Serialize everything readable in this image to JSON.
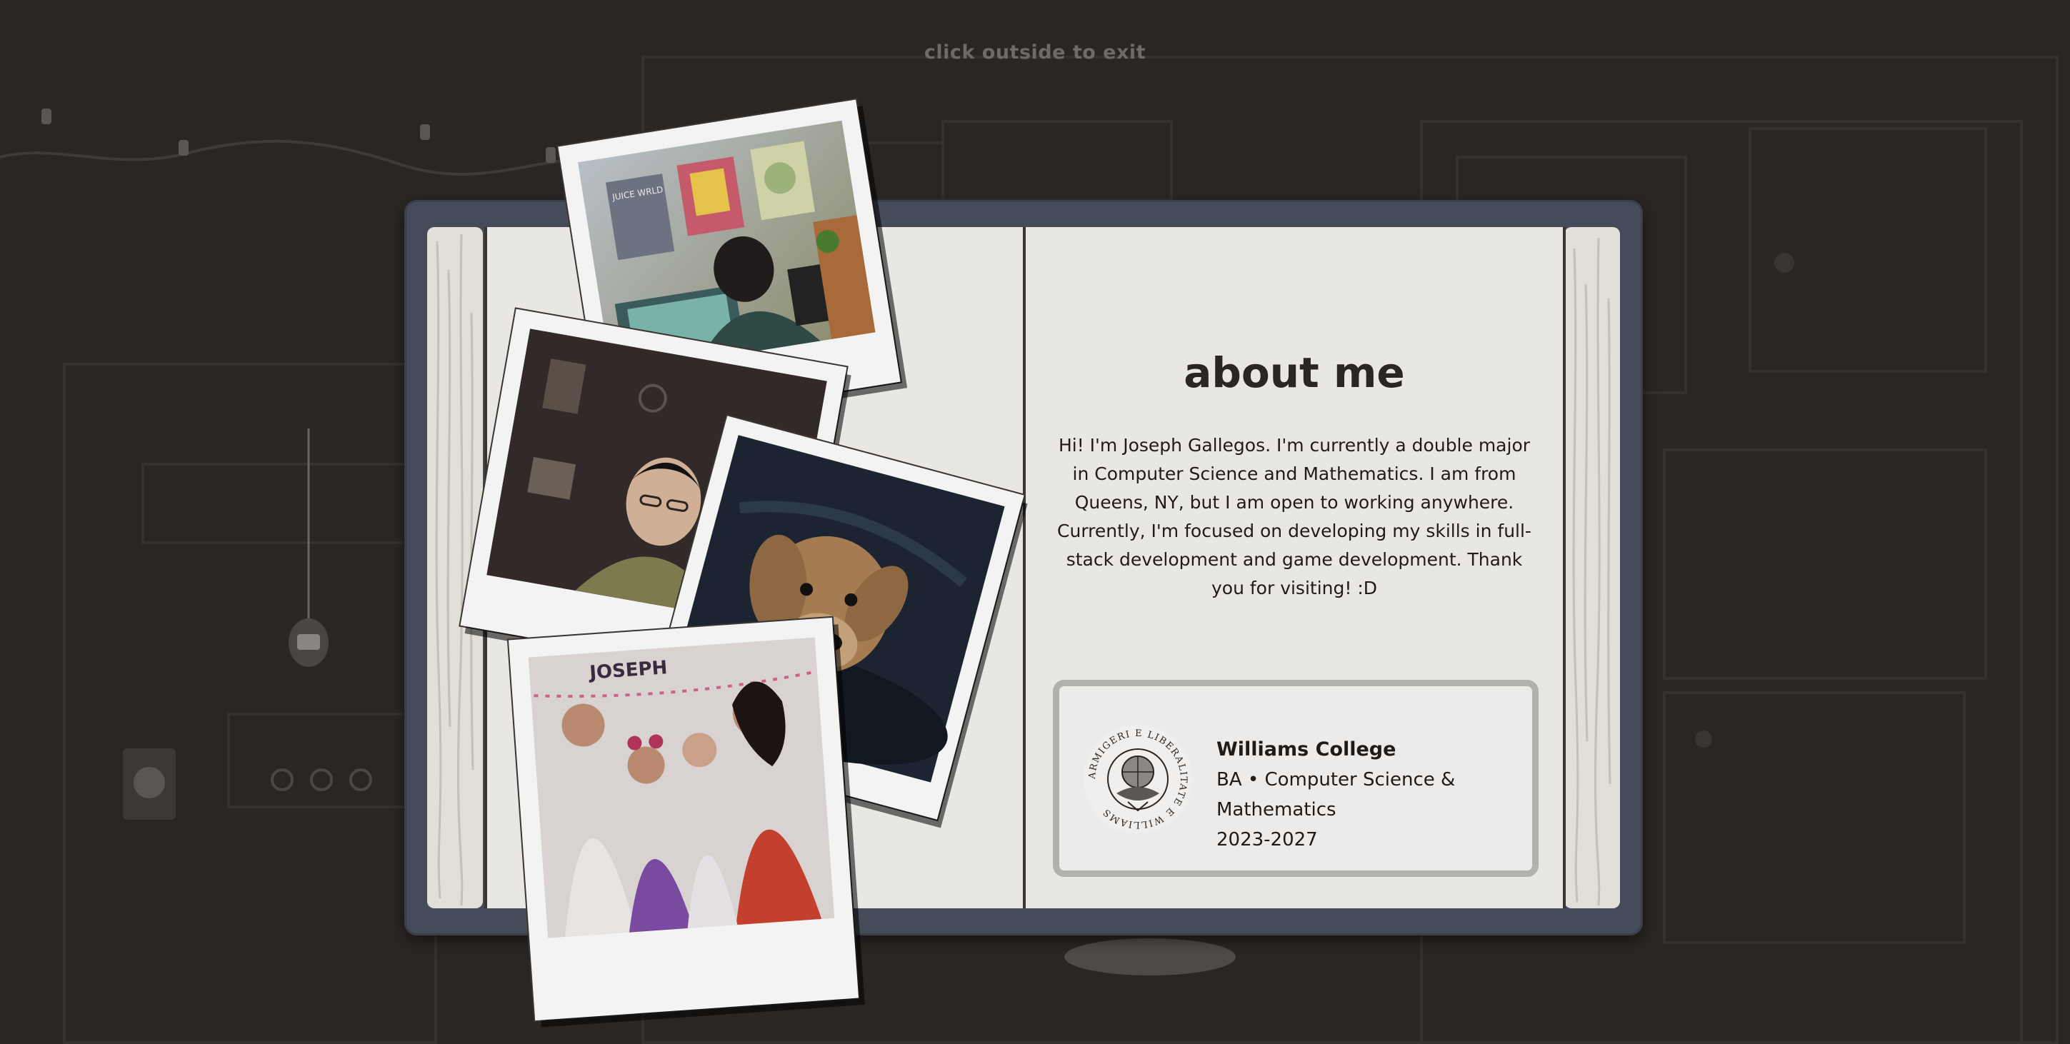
{
  "hint": "click outside to exit",
  "about": {
    "title": "about me",
    "bio": "Hi! I'm Joseph Gallegos. I'm currently a double major in Computer Science and Mathematics. I am from Queens, NY, but I am open to working anywhere. Currently, I'm focused on developing my skills in full-stack development and game development. Thank you for visiting! :D"
  },
  "education": {
    "school": "Williams College",
    "degree": "BA • Computer Science & Mathematics",
    "years": "2023-2027",
    "seal_text": "ARMIGERI E LIBERALITATE E WILLIAMS"
  },
  "photos": [
    {
      "name": "photo-gaming-setup",
      "poster_text": "JUICE WRLD"
    },
    {
      "name": "photo-portrait"
    },
    {
      "name": "photo-dog"
    },
    {
      "name": "photo-family",
      "banner_text": "JOSEPH"
    }
  ],
  "colors": {
    "background": "#2a2624",
    "book_cover": "#454b59",
    "page": "#e9e7e4",
    "ink": "#1f1b19"
  }
}
